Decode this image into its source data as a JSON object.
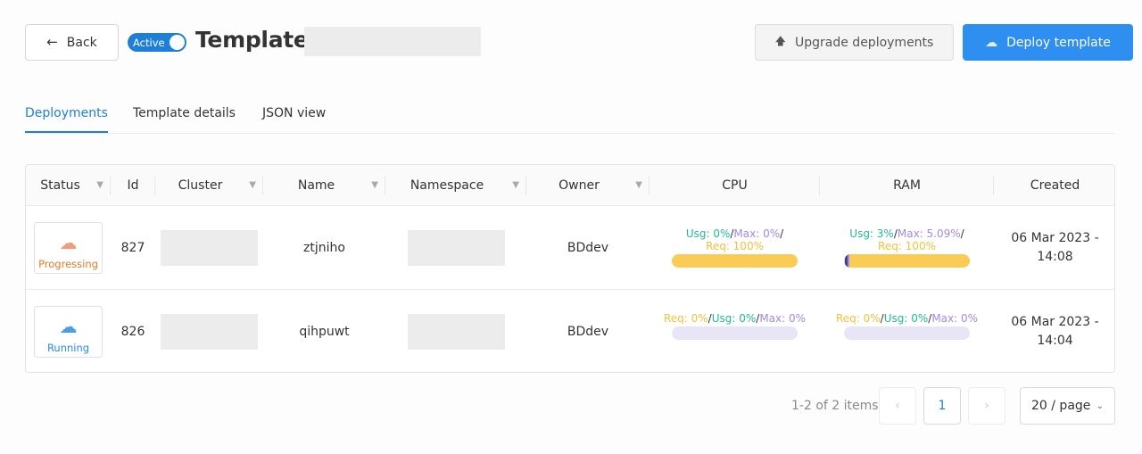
{
  "header": {
    "back_label": "Back",
    "back_icon": "arrow-left-icon",
    "toggle_label": "Active",
    "toggle_on": true,
    "title": "Template:",
    "upgrade_label": "Upgrade deployments",
    "upgrade_icon": "arrow-up-icon",
    "deploy_label": "Deploy template",
    "deploy_icon": "cloud-upload-icon",
    "accent_color": "#2f8ff0"
  },
  "tabs": [
    {
      "label": "Deployments",
      "active": true
    },
    {
      "label": "Template details",
      "active": false
    },
    {
      "label": "JSON view",
      "active": false
    }
  ],
  "table": {
    "columns": [
      {
        "label": "Status",
        "filter": true
      },
      {
        "label": "Id",
        "filter": false
      },
      {
        "label": "Cluster",
        "filter": true
      },
      {
        "label": "Name",
        "filter": true
      },
      {
        "label": "Namespace",
        "filter": true
      },
      {
        "label": "Owner",
        "filter": true
      },
      {
        "label": "CPU",
        "filter": false
      },
      {
        "label": "RAM",
        "filter": false
      },
      {
        "label": "Created",
        "filter": false
      }
    ],
    "rows": [
      {
        "status": "Progressing",
        "status_icon": "cloud-warning-icon",
        "id": "827",
        "name": "ztjniho",
        "owner": "BDdev",
        "cpu": {
          "usg": "Usg: 0%",
          "max": "Max: 0%",
          "req": "Req: 100%",
          "sep": "/",
          "fill_percent": 100
        },
        "ram": {
          "usg": "Usg: 3%",
          "max": "Max: 5.09%",
          "req": "Req: 100%",
          "sep": "/",
          "fill_percent": 100
        },
        "created_date": "06 Mar 2023 -",
        "created_time": "14:08"
      },
      {
        "status": "Running",
        "status_icon": "cloud-bolt-icon",
        "id": "826",
        "name": "qihpuwt",
        "owner": "BDdev",
        "cpu": {
          "req": "Req: 0%",
          "usg": "Usg: 0%",
          "max": "Max: 0%",
          "sep": "/",
          "fill_percent": 0
        },
        "ram": {
          "req": "Req: 0%",
          "usg": "Usg: 0%",
          "max": "Max: 0%",
          "sep": "/",
          "fill_percent": 0
        },
        "created_date": "06 Mar 2023 -",
        "created_time": "14:04"
      }
    ]
  },
  "pagination": {
    "summary": "1-2 of 2 items",
    "prev_icon": "chevron-left-icon",
    "current_page": "1",
    "next_icon": "chevron-right-icon",
    "page_size": "20 / page",
    "page_size_icon": "chevron-down-icon"
  }
}
